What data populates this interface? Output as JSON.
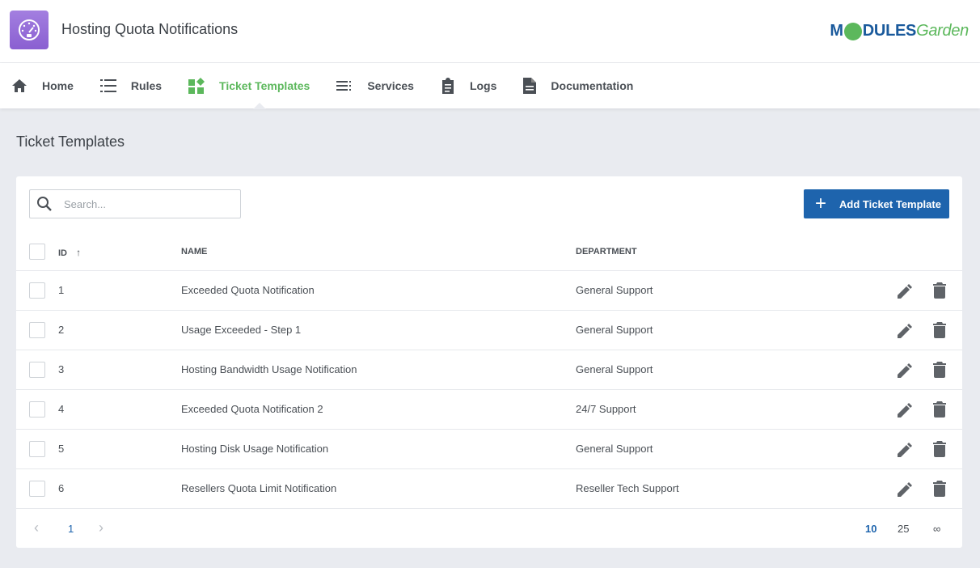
{
  "header": {
    "title": "Hosting Quota Notifications"
  },
  "logo": {
    "part1": "M",
    "part2": "DULES",
    "part3": "Garden"
  },
  "nav": [
    {
      "label": "Home",
      "icon": "home-icon"
    },
    {
      "label": "Rules",
      "icon": "list-icon"
    },
    {
      "label": "Ticket Templates",
      "icon": "widgets-icon",
      "active": true
    },
    {
      "label": "Services",
      "icon": "services-icon"
    },
    {
      "label": "Logs",
      "icon": "clipboard-icon"
    },
    {
      "label": "Documentation",
      "icon": "document-icon"
    }
  ],
  "page": {
    "title": "Ticket Templates"
  },
  "toolbar": {
    "search_placeholder": "Search...",
    "add_label": "Add Ticket Template"
  },
  "table": {
    "columns": {
      "id": "ID",
      "name": "NAME",
      "department": "DEPARTMENT"
    },
    "rows": [
      {
        "id": "1",
        "name": "Exceeded Quota Notification",
        "department": "General Support"
      },
      {
        "id": "2",
        "name": "Usage Exceeded - Step 1",
        "department": "General Support"
      },
      {
        "id": "3",
        "name": "Hosting Bandwidth Usage Notification",
        "department": "General Support"
      },
      {
        "id": "4",
        "name": "Exceeded Quota Notification 2",
        "department": "24/7 Support"
      },
      {
        "id": "5",
        "name": "Hosting Disk Usage Notification",
        "department": "General Support"
      },
      {
        "id": "6",
        "name": "Resellers Quota Limit Notification",
        "department": "Reseller Tech Support"
      }
    ]
  },
  "pagination": {
    "current_page": "1",
    "sizes": [
      "10",
      "25",
      "∞"
    ],
    "selected_size": "10"
  },
  "colors": {
    "accent": "#5cb85c",
    "primary": "#1e64ad",
    "app_icon": "#8a5fd1"
  }
}
